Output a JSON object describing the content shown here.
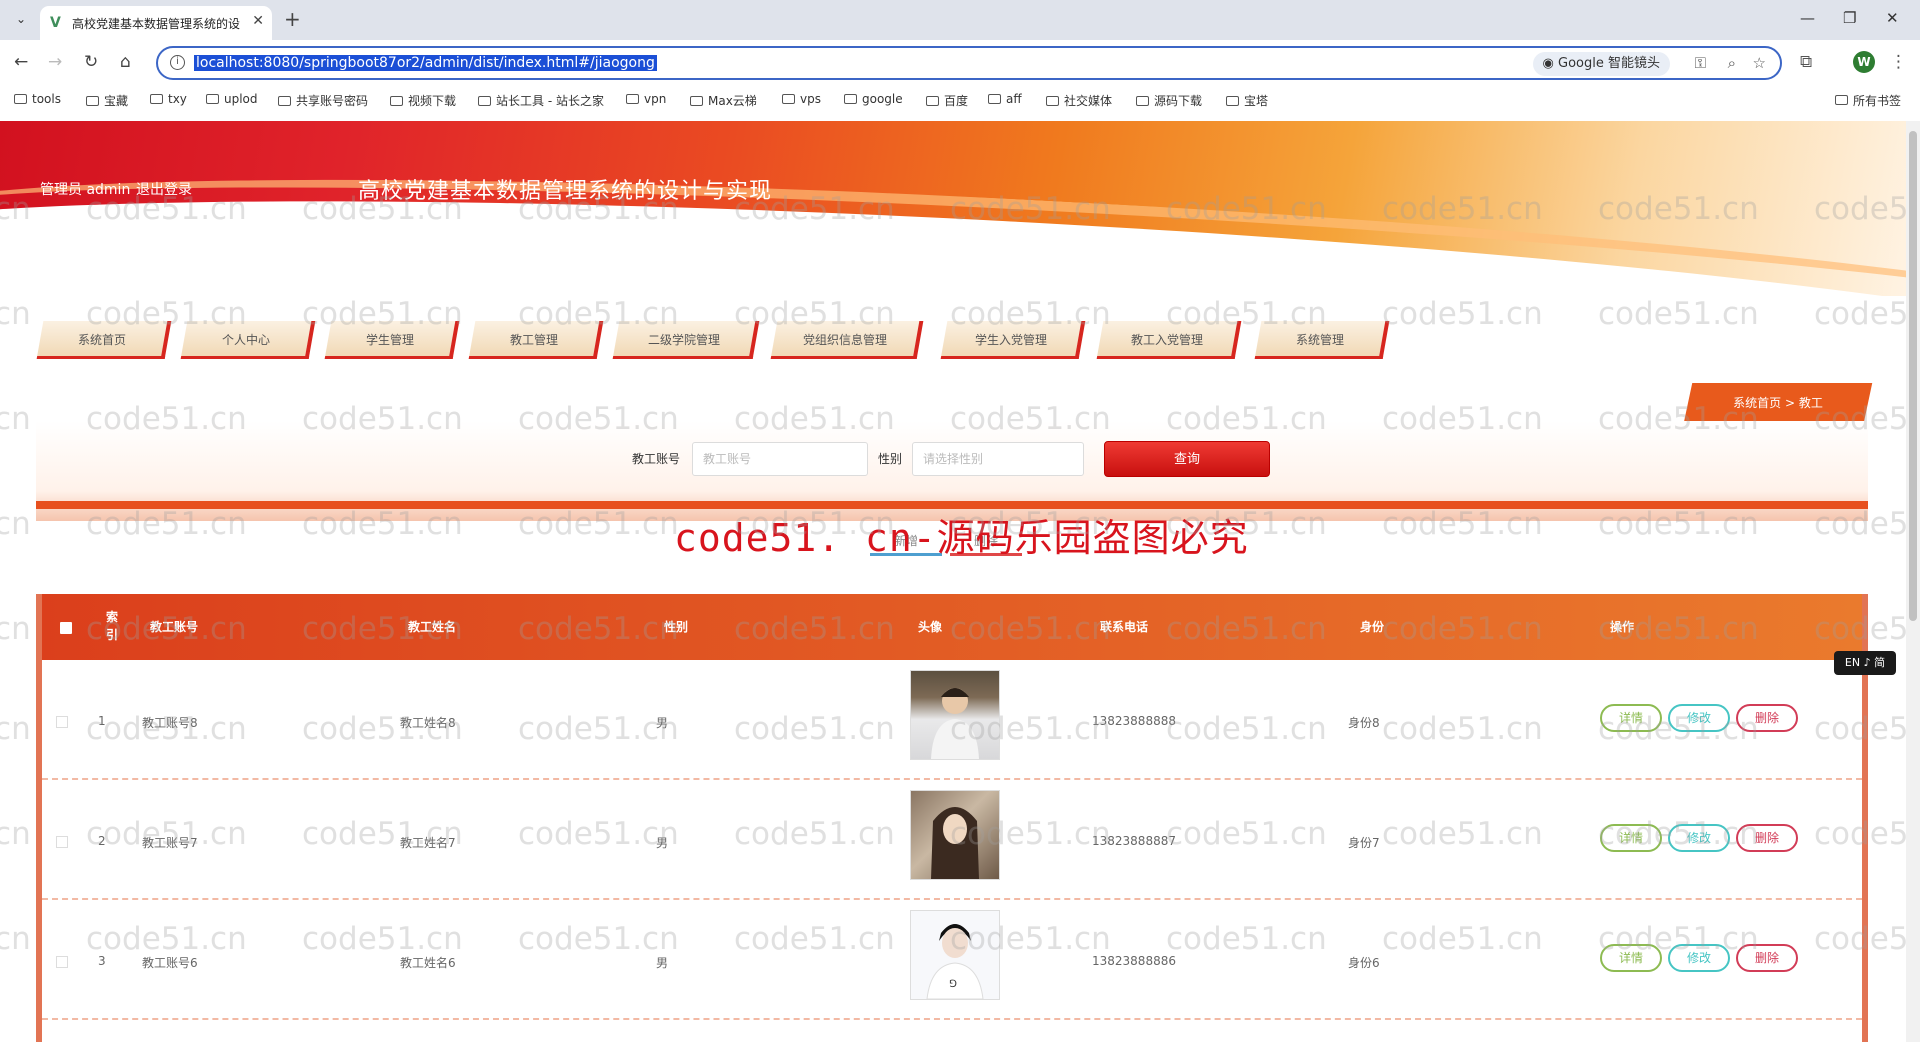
{
  "browser": {
    "tab_title": "高校党建基本数据管理系统的设",
    "url": "localhost:8080/springboot87or2/admin/dist/index.html#/jiaogong",
    "lens_label": "Google 智能镜头",
    "profile_initial": "W",
    "bookmarks": [
      "tools",
      "宝藏",
      "txy",
      "uplod",
      "共享账号密码",
      "视频下载",
      "站长工具 - 站长之家",
      "vpn",
      "Max云梯",
      "vps",
      "google",
      "百度",
      "aff",
      "社交媒体",
      "源码下载",
      "宝塔"
    ],
    "all_bookmarks": "所有书签"
  },
  "header": {
    "user_label": "管理员 admin",
    "logout_label": "退出登录",
    "system_title": "高校党建基本数据管理系统的设计与实现"
  },
  "menu": [
    "系统首页",
    "个人中心",
    "学生管理",
    "教工管理",
    "二级学院管理",
    "党组织信息管理",
    "学生入党管理",
    "教工入党管理",
    "系统管理"
  ],
  "breadcrumb": "系统首页 > 教工",
  "search": {
    "account_label": "教工账号",
    "account_placeholder": "教工账号",
    "gender_label": "性别",
    "gender_placeholder": "请选择性别",
    "query_button": "查询"
  },
  "actions": {
    "add": "新增",
    "delete": "删除"
  },
  "watermark_banner": "code51. cn-源码乐园盗图必究",
  "watermark_text": "code51.cn",
  "table": {
    "headers": [
      "索引",
      "教工账号",
      "教工姓名",
      "性别",
      "头像",
      "联系电话",
      "身份",
      "操作"
    ],
    "rows": [
      {
        "index": "1",
        "account": "教工账号8",
        "name": "教工姓名8",
        "gender": "男",
        "phone": "13823888888",
        "identity": "身份8"
      },
      {
        "index": "2",
        "account": "教工账号7",
        "name": "教工姓名7",
        "gender": "男",
        "phone": "13823888887",
        "identity": "身份7"
      },
      {
        "index": "3",
        "account": "教工账号6",
        "name": "教工姓名6",
        "gender": "男",
        "phone": "13823888886",
        "identity": "身份6"
      }
    ],
    "row_buttons": {
      "detail": "详情",
      "edit": "修改",
      "delete": "删除"
    }
  },
  "ime_indicator": "EN ♪ 简",
  "colors": {
    "brand_red": "#d7261e",
    "brand_orange": "#e85a1c",
    "detail": "#8dbb52",
    "edit": "#46c5c4",
    "delete": "#d23c57"
  }
}
